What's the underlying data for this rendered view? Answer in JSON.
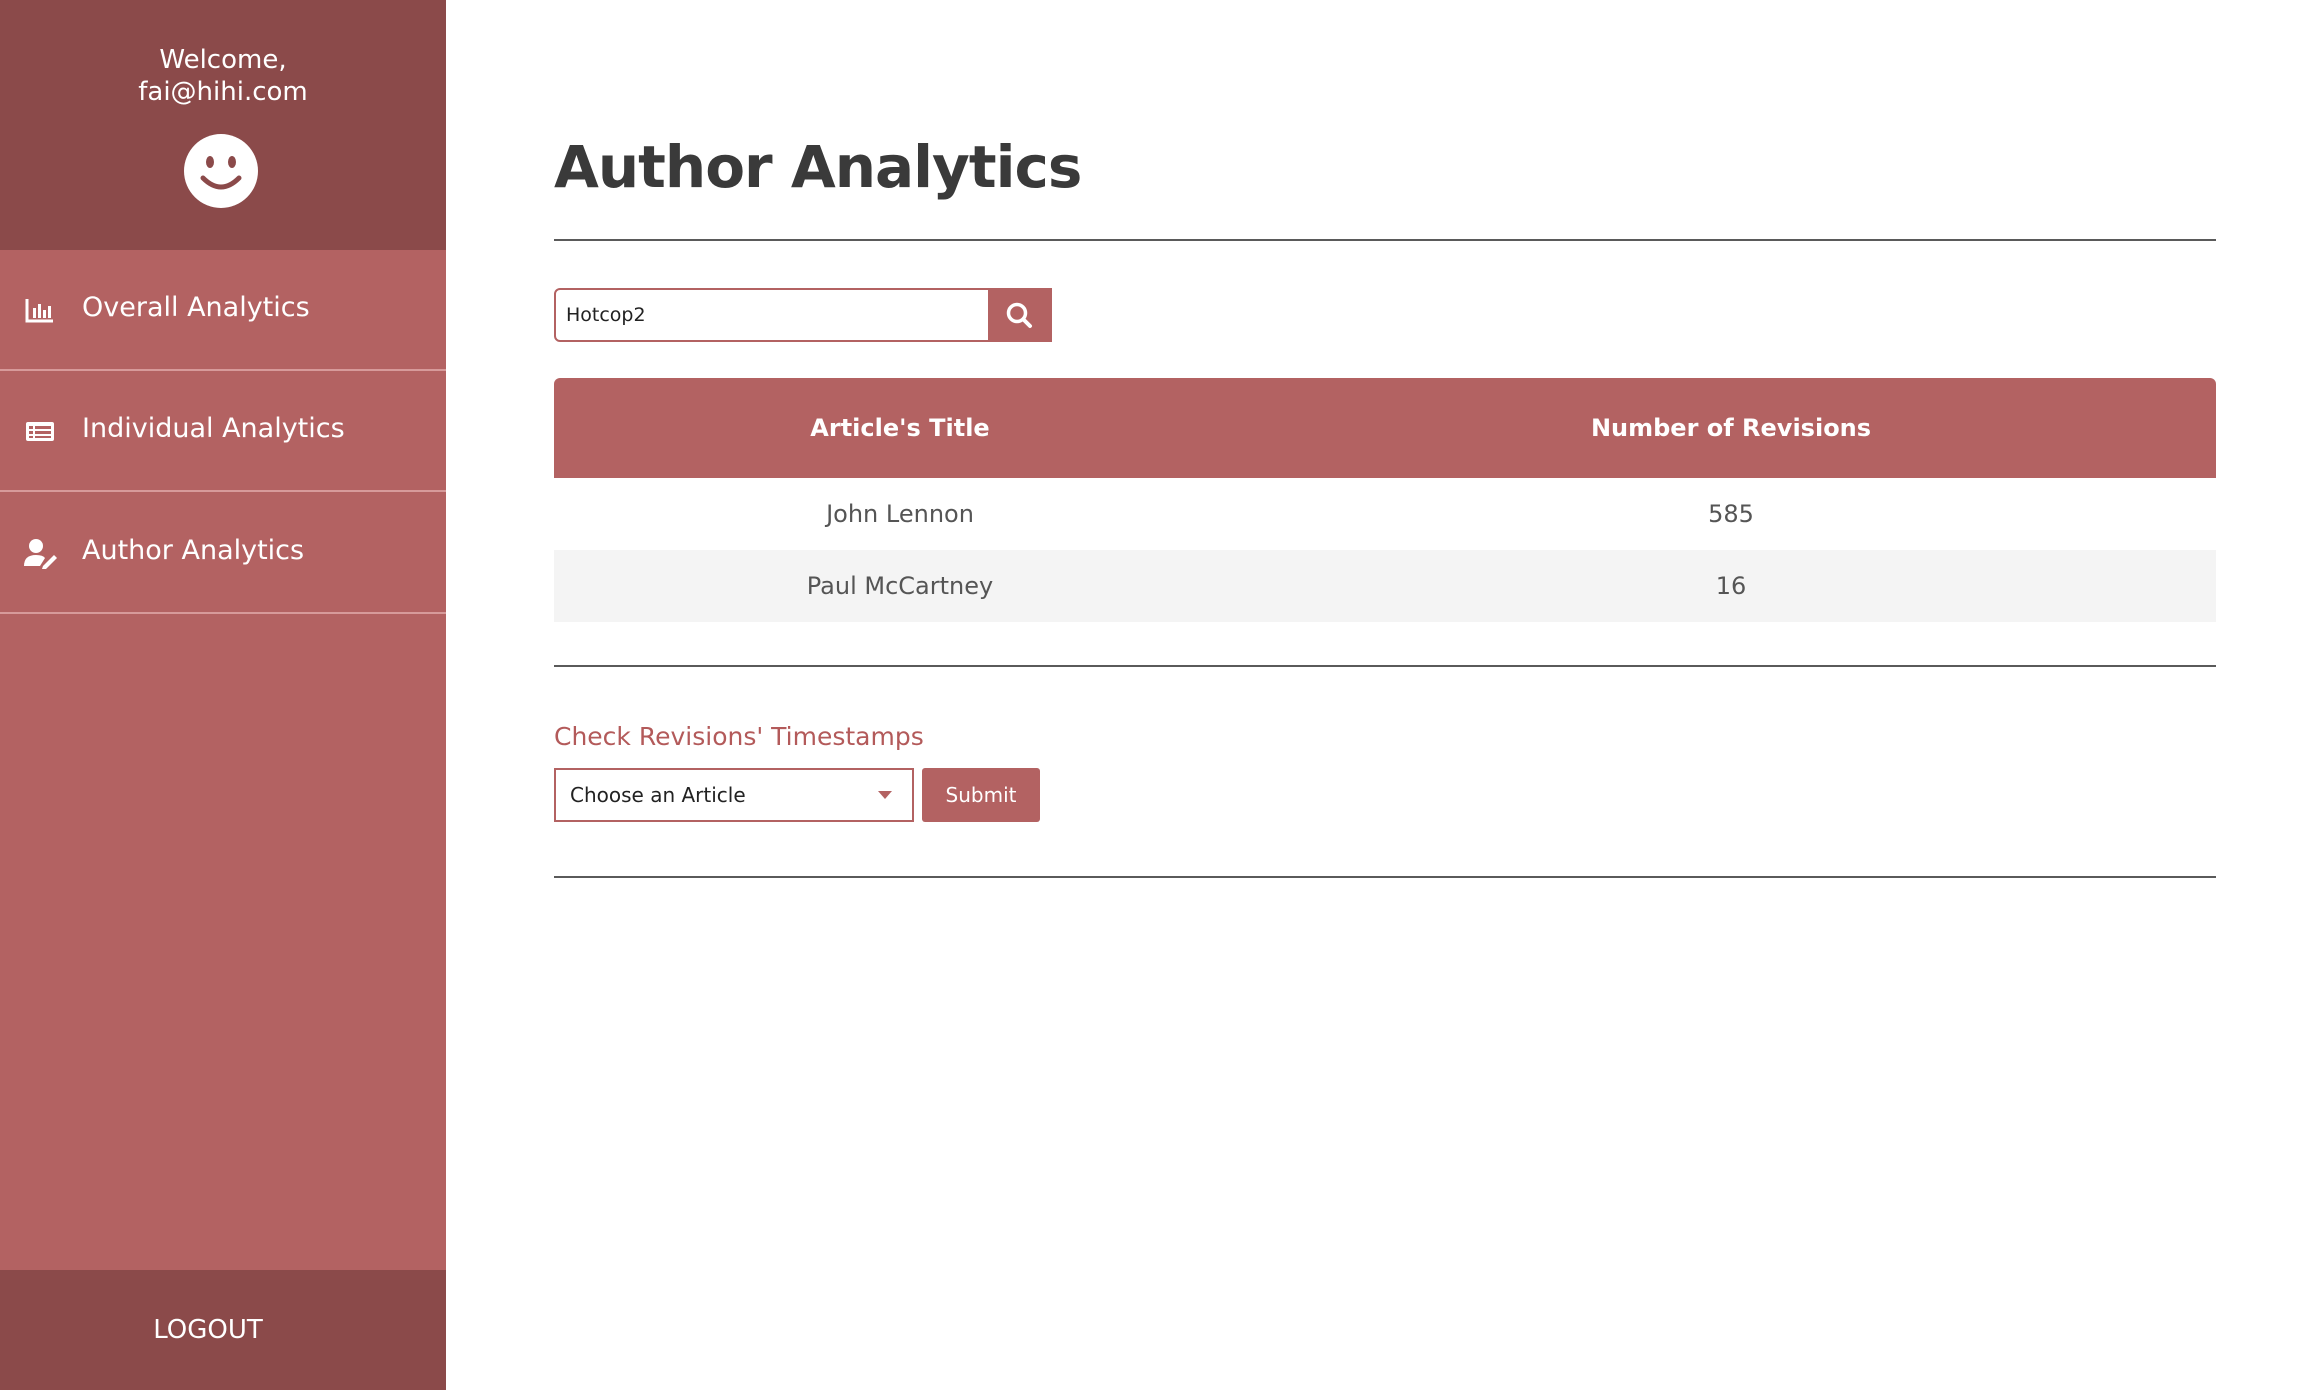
{
  "sidebar": {
    "welcome_line1": "Welcome,",
    "welcome_line2": "fai@hihi.com",
    "avatar_icon": "smiley-face-icon",
    "items": [
      {
        "label": "Overall Analytics",
        "icon": "bar-chart-icon"
      },
      {
        "label": "Individual Analytics",
        "icon": "list-card-icon"
      },
      {
        "label": "Author Analytics",
        "icon": "user-edit-icon"
      }
    ],
    "logout_label": "LOGOUT"
  },
  "main": {
    "page_title": "Author Analytics",
    "search": {
      "value": "Hotcop2",
      "button_icon": "search-icon"
    },
    "table": {
      "headers": [
        "Article's Title",
        "Number of Revisions"
      ],
      "rows": [
        [
          "John Lennon",
          "585"
        ],
        [
          "Paul McCartney",
          "16"
        ]
      ]
    },
    "timestamps": {
      "section_title": "Check Revisions' Timestamps",
      "select_value": "Choose an Article",
      "submit_label": "Submit"
    }
  },
  "colors": {
    "sidebar": "#b36262",
    "sidebar_dark": "#8b4a4a",
    "accent": "#b36262",
    "title_text": "#3a3a3a"
  }
}
